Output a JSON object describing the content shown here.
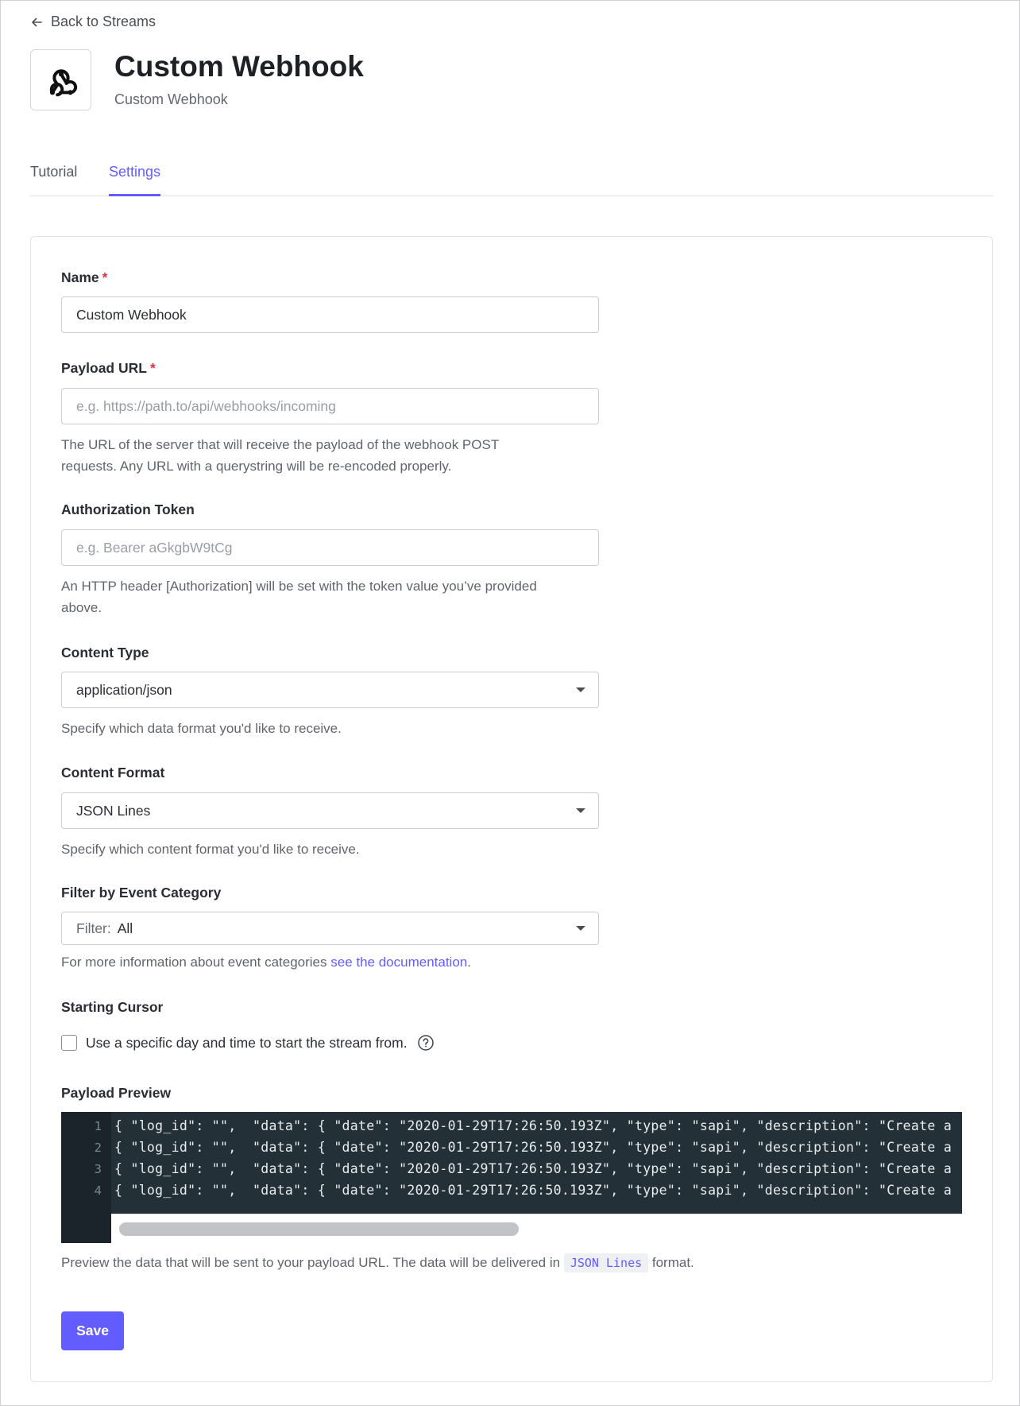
{
  "nav": {
    "back_label": "Back to Streams"
  },
  "header": {
    "title": "Custom Webhook",
    "subtitle": "Custom Webhook",
    "logo_icon": "webhook-icon"
  },
  "tabs": [
    {
      "label": "Tutorial",
      "active": false
    },
    {
      "label": "Settings",
      "active": true
    }
  ],
  "form": {
    "name": {
      "label": "Name",
      "required_mark": "*",
      "value": "Custom Webhook"
    },
    "payload_url": {
      "label": "Payload URL",
      "required_mark": "*",
      "value": "",
      "placeholder": "e.g. https://path.to/api/webhooks/incoming",
      "help_line1": "The URL of the server that will receive the payload of the webhook POST",
      "help_line2": "requests. Any URL with a querystring will be re-encoded properly."
    },
    "auth_token": {
      "label": "Authorization Token",
      "value": "",
      "placeholder": "e.g. Bearer aGkgbW9tCg",
      "help_line1": "An HTTP header [Authorization] will be set with the token value you’ve provided",
      "help_line2": "above."
    },
    "content_type": {
      "label": "Content Type",
      "value": "application/json",
      "help": "Specify which data format you'd like to receive."
    },
    "content_format": {
      "label": "Content Format",
      "value": "JSON Lines",
      "help": "Specify which content format you'd like to receive."
    },
    "filter": {
      "label": "Filter by Event Category",
      "prefix": "Filter:",
      "value": "All",
      "help_text": "For more information about event categories ",
      "help_link": "see the documentation",
      "help_suffix": "."
    },
    "starting_cursor": {
      "label": "Starting Cursor",
      "checkbox_label": "Use a specific day and time to start the stream from.",
      "checked": false,
      "icon": "help-circle-icon"
    },
    "payload_preview": {
      "label": "Payload Preview",
      "lines": [
        {
          "num": "1",
          "text": "{ \"log_id\": \"\",  \"data\": { \"date\": \"2020-01-29T17:26:50.193Z\", \"type\": \"sapi\", \"description\": \"Create a"
        },
        {
          "num": "2",
          "text": "{ \"log_id\": \"\",  \"data\": { \"date\": \"2020-01-29T17:26:50.193Z\", \"type\": \"sapi\", \"description\": \"Create a"
        },
        {
          "num": "3",
          "text": "{ \"log_id\": \"\",  \"data\": { \"date\": \"2020-01-29T17:26:50.193Z\", \"type\": \"sapi\", \"description\": \"Create a"
        },
        {
          "num": "4",
          "text": "{ \"log_id\": \"\",  \"data\": { \"date\": \"2020-01-29T17:26:50.193Z\", \"type\": \"sapi\", \"description\": \"Create a"
        }
      ],
      "help_before": "Preview the data that will be sent to your payload URL. The data will be delivered in ",
      "help_code": "JSON Lines",
      "help_after": " format."
    },
    "save_label": "Save"
  },
  "colors": {
    "accent": "#635dff",
    "required": "#e0344c",
    "code_bg": "#233037"
  }
}
